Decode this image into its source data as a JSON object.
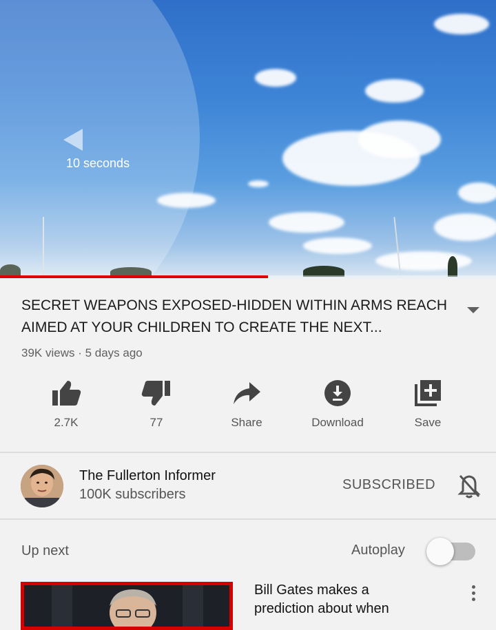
{
  "player": {
    "seek_text": "10 seconds",
    "progress_fraction": 0.54,
    "progress_color": "#e10000"
  },
  "video": {
    "title": "SECRET WEAPONS EXPOSED-HIDDEN WITHIN ARMS REACH AIMED AT YOUR CHILDREN TO CREATE THE NEXT...",
    "meta": "39K views · 5 days ago"
  },
  "actions": [
    {
      "label": "2.7K",
      "icon": "thumbs-up-icon"
    },
    {
      "label": "77",
      "icon": "thumbs-down-icon"
    },
    {
      "label": "Share",
      "icon": "share-icon"
    },
    {
      "label": "Download",
      "icon": "download-icon"
    },
    {
      "label": "Save",
      "icon": "playlist-add-icon"
    }
  ],
  "channel": {
    "name": "The Fullerton Informer",
    "subscribers": "100K subscribers",
    "subscribe_state": "SUBSCRIBED",
    "bell_icon": "notifications-off-icon"
  },
  "upnext": {
    "label": "Up next",
    "autoplay_label": "Autoplay",
    "autoplay_on": false,
    "next_video_title": "Bill Gates makes a prediction about when"
  }
}
